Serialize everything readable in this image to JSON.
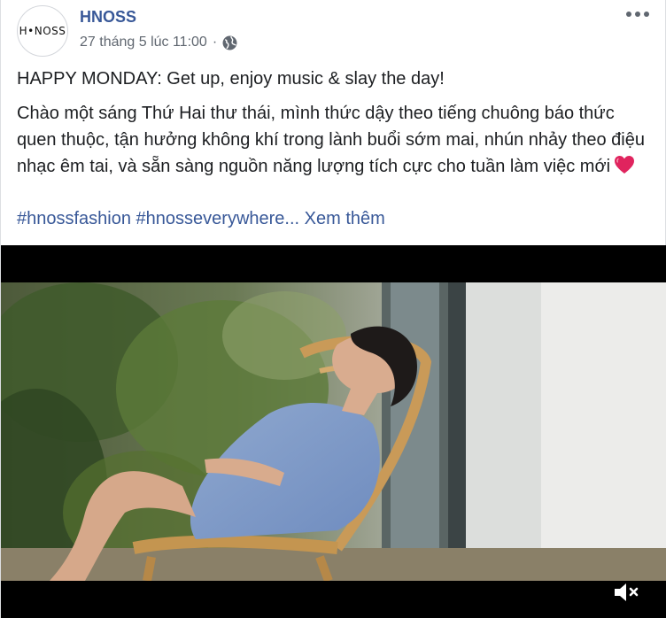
{
  "post": {
    "page_name": "HNOSS",
    "avatar_text": "H•NOSS",
    "timestamp": "27 tháng 5 lúc 11:00",
    "separator": "·",
    "privacy_icon": "globe-icon",
    "menu_icon": "more-options-icon"
  },
  "content": {
    "headline": "HAPPY MONDAY: Get up, enjoy music & slay the day!",
    "body": "Chào một sáng Thứ Hai thư thái, mình thức dậy theo tiếng chuông báo thức quen thuộc, tận hưởng không khí trong lành buổi sớm mai, nhún nhảy theo điệu nhạc êm tai, và sẵn sàng nguồn năng lượng tích cực cho tuần làm việc mới",
    "emoji_icon": "red-heart-icon",
    "hashtag1": "#hnossfashion",
    "hashtag2": "#hnosseverywhere",
    "ellipsis": "...",
    "see_more": "Xem thêm"
  },
  "video": {
    "mute_icon": "volume-muted-icon"
  },
  "colors": {
    "link": "#385898",
    "text": "#1c1e21",
    "meta": "#606770",
    "heart": "#e0245e"
  }
}
